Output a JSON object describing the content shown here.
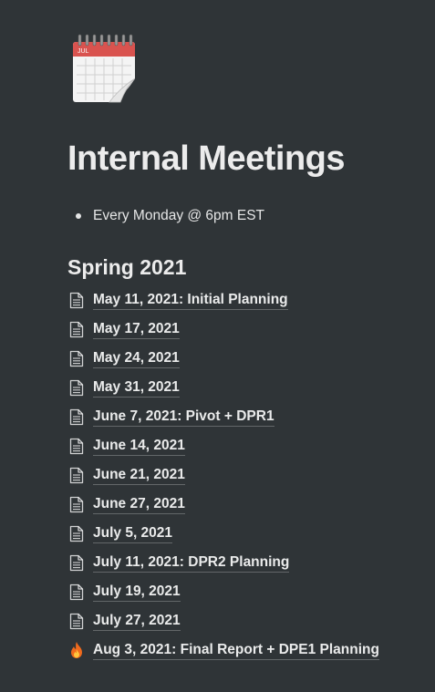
{
  "page": {
    "icon": "spiral-calendar-icon",
    "calendar_month": "JUL",
    "title": "Internal Meetings"
  },
  "bullets": [
    {
      "text": "Every Monday @ 6pm EST"
    }
  ],
  "section": {
    "heading": "Spring 2021"
  },
  "links": [
    {
      "label": "May 11, 2021: Initial Planning",
      "icon": "page-icon"
    },
    {
      "label": "May 17, 2021",
      "icon": "page-icon"
    },
    {
      "label": "May 24, 2021",
      "icon": "page-icon"
    },
    {
      "label": "May 31, 2021",
      "icon": "page-icon"
    },
    {
      "label": "June 7, 2021: Pivot + DPR1",
      "icon": "page-icon"
    },
    {
      "label": "June 14, 2021",
      "icon": "page-icon"
    },
    {
      "label": "June 21, 2021",
      "icon": "page-icon"
    },
    {
      "label": "June 27, 2021",
      "icon": "page-icon"
    },
    {
      "label": "July 5, 2021",
      "icon": "page-icon"
    },
    {
      "label": "July 11, 2021: DPR2 Planning",
      "icon": "page-icon"
    },
    {
      "label": "July 19, 2021",
      "icon": "page-icon"
    },
    {
      "label": "July 27, 2021",
      "icon": "page-icon"
    },
    {
      "label": "Aug 3, 2021: Final Report + DPE1 Planning",
      "icon": "fire-icon"
    }
  ],
  "colors": {
    "background": "#2f3437",
    "text": "#ececec",
    "calendar_red": "#d9534f"
  }
}
